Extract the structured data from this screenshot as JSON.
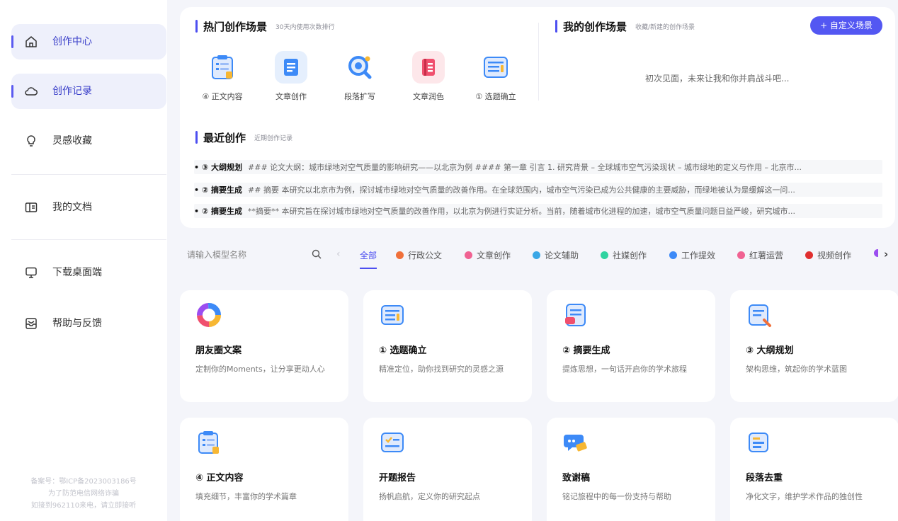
{
  "sidebar": {
    "items": [
      {
        "label": "创作中心",
        "icon": "home-icon"
      },
      {
        "label": "创作记录",
        "icon": "cloud-icon"
      },
      {
        "label": "灵感收藏",
        "icon": "lightbulb-icon"
      },
      {
        "label": "我的文档",
        "icon": "book-icon"
      },
      {
        "label": "下载桌面端",
        "icon": "monitor-icon"
      },
      {
        "label": "帮助与反馈",
        "icon": "inbox-icon"
      }
    ],
    "icp": [
      "备案号：鄂ICP备2023003186号",
      "为了防范电信网络诈骗",
      "如接到962110来电，请立即接听"
    ]
  },
  "hot": {
    "title": "热门创作场景",
    "subtitle": "30天内使用次数排行",
    "items": [
      {
        "label": "④ 正文内容",
        "color": "#3d8af7"
      },
      {
        "label": "文章创作",
        "color": "#3d8af7"
      },
      {
        "label": "段落扩写",
        "color": "#3d8af7"
      },
      {
        "label": "文章润色",
        "color": "#f0506e"
      },
      {
        "label": "① 选题确立",
        "color": "#3d8af7"
      }
    ]
  },
  "mine": {
    "title": "我的创作场景",
    "subtitle": "收藏/新建的创作场景",
    "button": "+ 自定义场景",
    "empty": "初次见面，未来让我和你并肩战斗吧..."
  },
  "recent": {
    "title": "最近创作",
    "subtitle": "近期创作记录",
    "rows": [
      {
        "tag": "• ③ 大纲规划",
        "text": "### 论文大纲：城市绿地对空气质量的影响研究——以北京为例 #### 第一章 引言 1. 研究背景 – 全球城市空气污染现状 – 城市绿地的定义与作用 – 北京市..."
      },
      {
        "tag": "• ② 摘要生成",
        "text": "## 摘要 本研究以北京市为例，探讨城市绿地对空气质量的改善作用。在全球范围内，城市空气污染已成为公共健康的主要威胁，而绿地被认为是缓解这一问..."
      },
      {
        "tag": "• ② 摘要生成",
        "text": "**摘要** 本研究旨在探讨城市绿地对空气质量的改善作用，以北京为例进行实证分析。当前，随着城市化进程的加速，城市空气质量问题日益严峻，研究城市..."
      }
    ]
  },
  "filter": {
    "search_placeholder": "请输入模型名称",
    "categories": [
      {
        "label": "全部",
        "color": ""
      },
      {
        "label": "行政公文",
        "color": "#f0703a"
      },
      {
        "label": "文章创作",
        "color": "#f06292"
      },
      {
        "label": "论文辅助",
        "color": "#3aa7e6"
      },
      {
        "label": "社媒创作",
        "color": "#2fd3a0"
      },
      {
        "label": "工作提效",
        "color": "#3d8af7"
      },
      {
        "label": "红薯运营",
        "color": "#f06292"
      },
      {
        "label": "视频创作",
        "color": "#e02f2f"
      }
    ]
  },
  "cards": [
    {
      "title": "朋友圈文案",
      "desc": "定制你的Moments，让分享更动人心",
      "icon": "ring-icon"
    },
    {
      "title": "① 选题确立",
      "desc": "精准定位，助你找到研究的灵感之源",
      "icon": "document-list-icon"
    },
    {
      "title": "② 摘要生成",
      "desc": "提炼思想，一句话开启你的学术旅程",
      "icon": "summary-icon"
    },
    {
      "title": "③ 大纲规划",
      "desc": "架构思维，筑起你的学术蓝图",
      "icon": "outline-icon"
    },
    {
      "title": "④ 正文内容",
      "desc": "填充细节，丰富你的学术篇章",
      "icon": "clipboard-icon"
    },
    {
      "title": "开题报告",
      "desc": "扬帆启航，定义你的研究起点",
      "icon": "report-icon"
    },
    {
      "title": "致谢稿",
      "desc": "铭记旅程中的每一份支持与帮助",
      "icon": "chat-icon"
    },
    {
      "title": "段落去重",
      "desc": "净化文字，维护学术作品的独创性",
      "icon": "dedupe-icon"
    }
  ]
}
